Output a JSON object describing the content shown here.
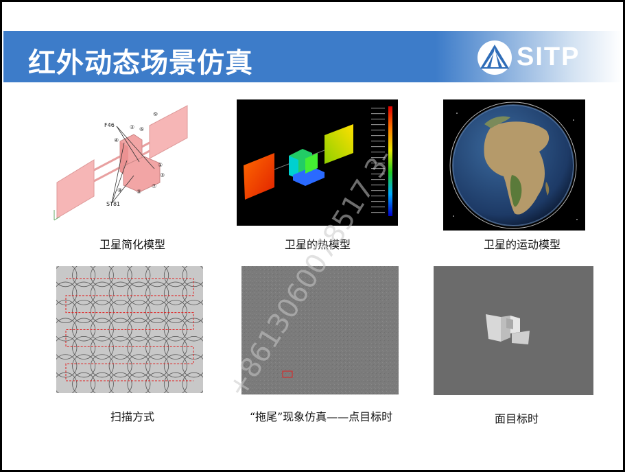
{
  "slide": {
    "title": "红外动态场景仿真",
    "logo": {
      "text": "SITP",
      "icon": "sitp-triangle-logo"
    }
  },
  "figures": [
    {
      "id": "simplified-model",
      "caption": "卫星简化模型",
      "labels": {
        "part": "F46",
        "strut": "ST81",
        "n1": "①",
        "n2": "②",
        "n3": "③",
        "n4": "④",
        "n5": "⑤",
        "n6": "⑥",
        "n7": "⑦",
        "n8": "⑧",
        "n9": "⑨"
      }
    },
    {
      "id": "thermal-model",
      "caption": "卫星的热模型"
    },
    {
      "id": "motion-model",
      "caption": "卫星的运动模型"
    },
    {
      "id": "scan-mode",
      "caption": "扫描方式"
    },
    {
      "id": "smear-sim",
      "caption": "“拖尾”现象仿真——点目标时"
    },
    {
      "id": "area-target",
      "caption": "面目标时"
    }
  ],
  "watermark": "+8613060078517 3-"
}
